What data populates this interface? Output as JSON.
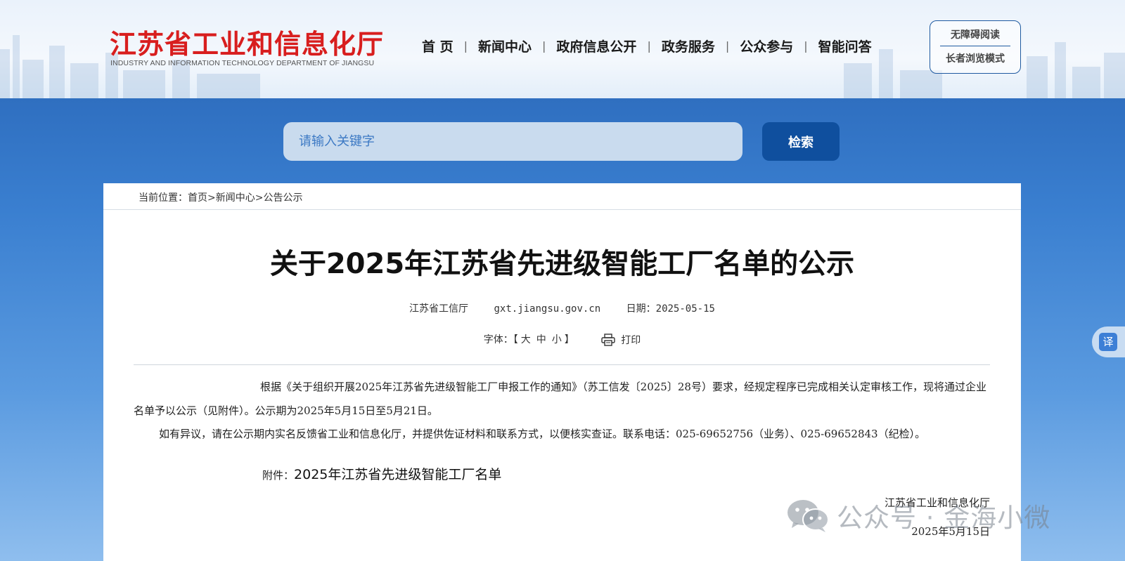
{
  "header": {
    "logo_cn": "江苏省工业和信息化厅",
    "logo_en": "INDUSTRY AND INFORMATION TECHNOLOGY DEPARTMENT OF JIANGSU",
    "nav": [
      "首 页",
      "新闻中心",
      "政府信息公开",
      "政务服务",
      "公众参与",
      "智能问答"
    ],
    "nav_separator": "|",
    "accessibility": {
      "top": "无障碍阅读",
      "bottom": "长者浏览模式"
    }
  },
  "search": {
    "placeholder": "请输入关键字",
    "button": "检索"
  },
  "breadcrumb": {
    "label": "当前位置：",
    "items": [
      "首页",
      "新闻中心",
      "公告公示"
    ],
    "separator": ">"
  },
  "article": {
    "title": "关于2025年江苏省先进级智能工厂名单的公示",
    "source": "江苏省工信厅",
    "site": "gxt.jiangsu.gov.cn",
    "date_label": "日期：",
    "date": "2025-05-15",
    "font_label": "字体：",
    "font_open": "【",
    "font_sizes": [
      "大",
      "中",
      "小"
    ],
    "font_close": "】",
    "print": "打印",
    "paragraphs": [
      "根据《关于组织开展2025年江苏省先进级智能工厂申报工作的通知》（苏工信发〔2025〕28号）要求，经规定程序已完成相关认定审核工作，现将通过企业名单予以公示（见附件）。公示期为2025年5月15日至5月21日。",
      "如有异议，请在公示期内实名反馈省工业和信息化厅，并提供佐证材料和联系方式，以便核实查证。联系电话：025-69652756（业务）、025-69652843（纪检）。"
    ],
    "attachment_label": "附件：",
    "attachment_name": "2025年江苏省先进级智能工厂名单",
    "sign_org": "江苏省工业和信息化厅",
    "sign_date": "2025年5月15日"
  },
  "watermark": "公众号 · 金海小微",
  "translate": "译",
  "colors": {
    "brand_red": "#d81e1e",
    "brand_blue": "#0f4f9e",
    "page_bg": "#2f6fc0"
  }
}
